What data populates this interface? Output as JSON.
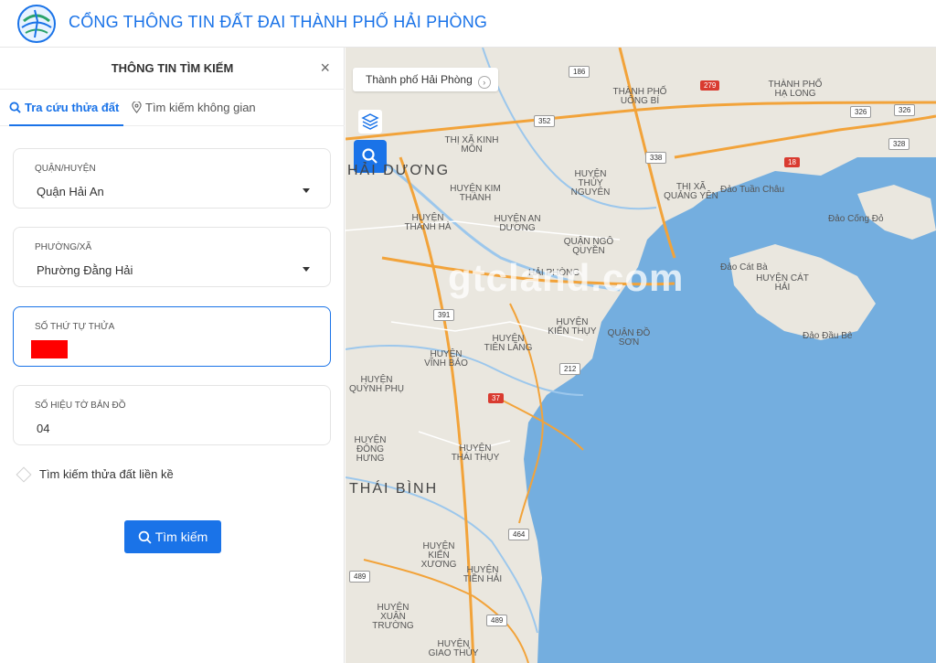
{
  "header": {
    "title": "CỔNG THÔNG TIN ĐẤT ĐAI THÀNH PHỐ HẢI PHÒNG"
  },
  "panel": {
    "title": "THÔNG TIN TÌM KIẾM",
    "close_glyph": "×",
    "tabs": [
      {
        "label": "Tra cứu thửa đất",
        "icon": "search-icon",
        "active": true
      },
      {
        "label": "Tìm kiếm không gian",
        "icon": "map-pin-icon",
        "active": false
      }
    ],
    "fields": {
      "district": {
        "label": "QUẬN/HUYỆN",
        "value": "Quận Hải An"
      },
      "ward": {
        "label": "PHƯỜNG/XÃ",
        "value": "Phường Đằng Hải"
      },
      "parcel_no": {
        "label": "SỐ THỨ TỰ THỬA",
        "value": ""
      },
      "map_sheet": {
        "label": "SỐ HIỆU TỜ BẢN ĐỒ",
        "value": "04"
      }
    },
    "adjacent_checkbox": {
      "label": "Tìm kiếm thửa đất liền kề",
      "checked": false
    },
    "search_button": "Tìm kiếm"
  },
  "map": {
    "location_chip": "Thành phố Hải Phòng",
    "watermark": "gtcland.com",
    "colors": {
      "water": "#74aedf",
      "land": "#eae7df",
      "accent": "#1a73e8",
      "highway": "#f2a33a"
    },
    "labels": {
      "hai_duong": "HẢI DƯƠNG",
      "thai_binh": "THÁI BÌNH",
      "uong_bi": "THÀNH PHỐ UÔNG BÍ",
      "ha_long": "THÀNH PHỐ HẠ LONG",
      "thuy_nguyen": "HUYỆN THỦY NGUYÊN",
      "kim_thanh": "HUYỆN KIM THÀNH",
      "thanh_ha": "HUYỆN THANH HÀ",
      "an_duong": "HUYỆN AN DƯƠNG",
      "quang_yen": "THỊ XÃ QUẢNG YÊN",
      "tuan_chau": "Đảo Tuần Châu",
      "cong_do": "Đảo Cống Đỏ",
      "cat_ba": "Đảo Cát Bà",
      "cat_hai": "HUYỆN CÁT HẢI",
      "dau_be": "Đảo Đầu Bê",
      "kien_thuy": "HUYỆN KIẾN THỤY",
      "do_son": "QUẬN ĐỒ SƠN",
      "tien_lang": "HUYỆN TIÊN LÃNG",
      "vinh_bao": "HUYỆN VĨNH BẢO",
      "quynh_phu": "HUYỆN QUỲNH PHỤ",
      "thai_thuy": "HUYỆN THÁI THỤY",
      "dong_hung": "HUYỆN ĐÔNG HƯNG",
      "kien_xuong": "HUYỆN KIẾN XƯƠNG",
      "tien_hai": "HUYỆN TIỀN HẢI",
      "xuan_truong": "HUYỆN XUÂN TRƯỜNG",
      "giao_thuy": "HUYỆN GIAO THỦY",
      "ngo_quyen": "QUẬN NGÔ QUYỀN",
      "kinh_mon": "THỊ XÃ KINH MÔN",
      "thanh_pho_hai_phong": "HẢI PHÒNG"
    },
    "shields": {
      "r186": "186",
      "r279": "279",
      "r352": "352",
      "r338": "338",
      "r18": "18",
      "r326a": "326",
      "r326b": "326",
      "r328": "328",
      "r391": "391",
      "r212": "212",
      "r37": "37",
      "r464": "464",
      "r489a": "489",
      "r489b": "489"
    }
  }
}
